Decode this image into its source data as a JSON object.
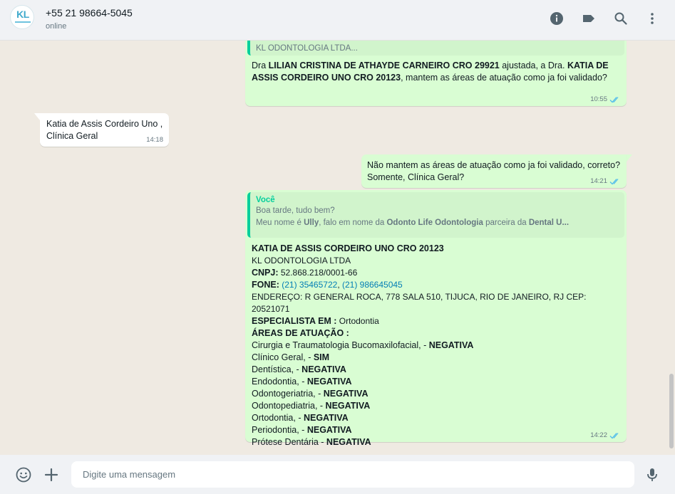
{
  "header": {
    "contact_name": "+55 21 98664-5045",
    "status": "online",
    "avatar_initials": "KL",
    "icons": [
      "info-icon",
      "label-icon",
      "search-icon",
      "menu-icon"
    ]
  },
  "messages": [
    {
      "quote_text": "KL ODONTOLOGIA LTDA...",
      "time": "10:55",
      "text_parts": {
        "p1": "Dra ",
        "p2": "LILIAN CRISTINA DE ATHAYDE CARNEIRO CRO 29921",
        "p3": " ajustada, a Dra.  ",
        "p4": "KATIA DE ASSIS CORDEIRO UNO CRO 20123",
        "p5": ", mantem as áreas de atuação como ja foi validado?"
      }
    },
    {
      "line1": "Katia de Assis Cordeiro Uno  ,",
      "line2": "Clínica Geral",
      "time": "14:18"
    },
    {
      "line1": "Não mantem as áreas de atuação como ja foi validado, correto?",
      "line2": "Somente, Clínica Geral?",
      "time": "14:21"
    },
    {
      "quote_author": "Você",
      "quote_line1": "Boa tarde, tudo bem?",
      "quote_line2": {
        "a": "Meu nome é ",
        "b": "Ully",
        "c": ", falo em nome da ",
        "d": "Odonto Life Odontologia",
        "e": " parceira da ",
        "f": "Dental U..."
      },
      "title": "KATIA DE ASSIS CORDEIRO UNO CRO 20123",
      "company": " KL ODONTOLOGIA LTDA",
      "cnpj_label": "CNPJ:",
      "cnpj_value": " 52.868.218/0001-66",
      "fone_label": "FONE:",
      "fone_sep1": " ",
      "phone1": "(21) 35465722",
      "fone_sep2": ",    ",
      "phone2": "(21) 986645045",
      "address": "ENDEREÇO: R GENERAL ROCA, 778 SALA 510, TIJUCA, RIO DE JANEIRO, RJ CEP: 20521071",
      "specialist_label": "ESPECIALISTA EM :",
      "specialist_value": " Ortodontia",
      "areas_label": "ÁREAS DE ATUAÇÃO :",
      "areas": [
        {
          "name": "Cirurgia e Traumatologia Bucomaxilofacial, - ",
          "status": "NEGATIVA"
        },
        {
          "name": "Clínico Geral, - ",
          "status": "SIM"
        },
        {
          "name": "Dentística, - ",
          "status": "NEGATIVA"
        },
        {
          "name": "Endodontia, - ",
          "status": "NEGATIVA"
        },
        {
          "name": "Odontogeriatria, - ",
          "status": "NEGATIVA"
        },
        {
          "name": "Odontopediatria, - ",
          "status": "NEGATIVA"
        },
        {
          "name": "Ortodontia, - ",
          "status": "NEGATIVA"
        },
        {
          "name": "Periodontia, - ",
          "status": "NEGATIVA"
        },
        {
          "name": "Prótese Dentária - ",
          "status": "NEGATIVA"
        }
      ],
      "time": "14:22"
    }
  ],
  "composer": {
    "placeholder": "Digite uma mensagem",
    "icons": [
      "emoji-icon",
      "attach-plus-icon",
      "microphone-icon"
    ]
  },
  "colors": {
    "outgoing_bubble": "#d9fdd3",
    "incoming_bubble": "#ffffff",
    "quote_accent": "#06cf9c",
    "read_ticks": "#53bdeb",
    "link": "#027eb5"
  }
}
